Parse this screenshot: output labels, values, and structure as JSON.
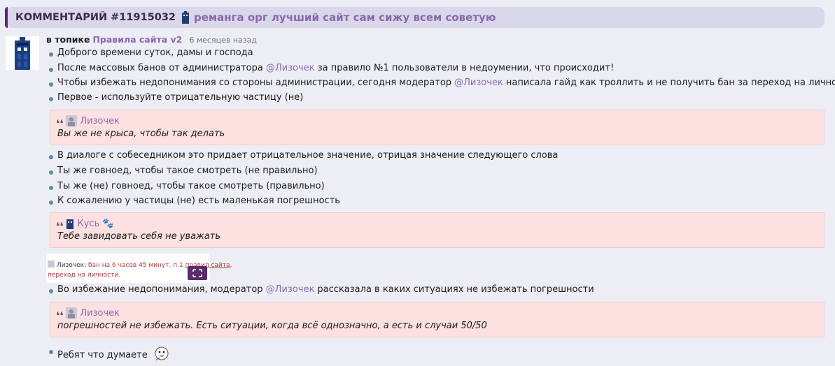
{
  "header": {
    "comment_id": "КОММЕНТАРИЙ #11915032",
    "title": "реманга орг лучший сайт сам сижу всем советую",
    "icon": "tardis-icon"
  },
  "meta": {
    "in_topic": "в топике",
    "topic": "Правила сайта v2",
    "ago": "6 месяцев назад"
  },
  "items": {
    "i1": "Доброго времени суток, дамы и господа",
    "i2_a": "После массовых банов от администратора ",
    "i2_mention": "@Лизочек",
    "i2_b": " за правило №1 пользователи в недоумении, что происходит!",
    "i3_a": "Чтобы избежать недопонимания со стороны администрации, сегодня модератор ",
    "i3_mention": "@Лизочек",
    "i3_b": " написала гайд как троллить и не получить бан за переход на личности",
    "i4": "Первое - используйте отрицательную частицу (не)",
    "i5": "В диалоге с собеседником это придает отрицательное значение, отрицая значение следующего слова",
    "i6": "Ты же говноед, чтобы такое смотреть (не правильно)",
    "i7": "Ты же (не) говноед, чтобы такое смотреть (правильно)",
    "i8": "К сожалению у частицы (не) есть маленькая погрешность",
    "i9_a": "Во избежание недопонимания, модератор ",
    "i9_mention": "@Лизочек",
    "i9_b": " рассказала в каких ситуациях не избежать погрешности",
    "i10": "Ребят что думаете"
  },
  "quotes": {
    "q1": {
      "author": "Лизочек",
      "text": "Вы же не крыса, чтобы так делать"
    },
    "q2": {
      "author": "Кусь",
      "text": "Тебе завидовать себя не уважать"
    },
    "q3": {
      "author": "Лизочек",
      "text": "погрешностей не избежать. Есть ситуации, когда всё однозначно, а есть и случаи 50/50"
    }
  },
  "screenshot": {
    "user": "Лизочек",
    "sep": ": ",
    "ban_text": "бан на 6 часов 45 минут. п.1 ",
    "rules_link": "правил сайта",
    "suffix": ",",
    "line2": "переход на личности."
  },
  "colors": {
    "header_bg": "#d9d7ea",
    "accent": "#5b2a6a",
    "link": "#8a68ad",
    "quote_bg": "#fde0e0",
    "bullet": "#5e8aa8"
  }
}
